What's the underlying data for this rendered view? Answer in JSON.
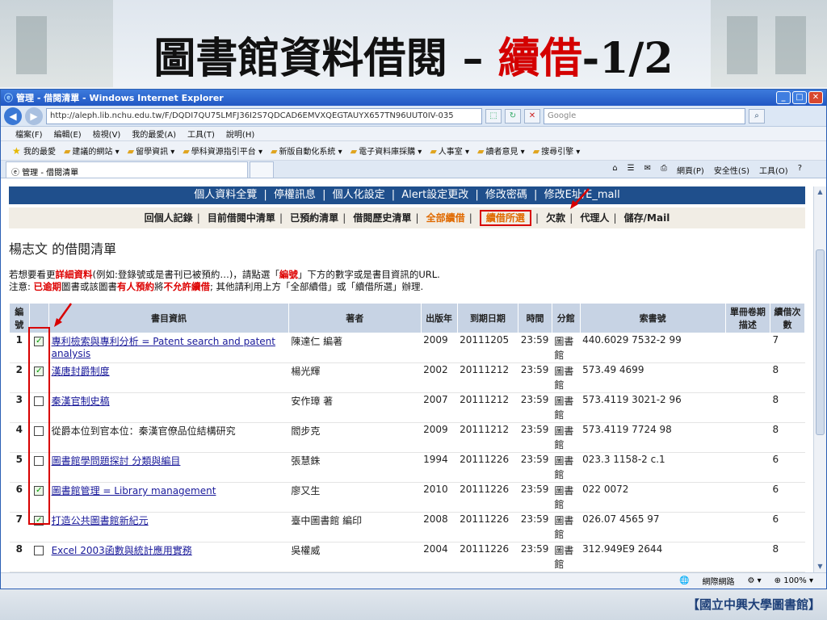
{
  "slide": {
    "title_main": "圖書館資料借閱 – ",
    "title_highlight": "續借",
    "title_suffix": "-1/2",
    "footer": "【國立中興大學圖書館】"
  },
  "browser": {
    "window_title": "管理 - 借閱清單 - Windows Internet Explorer",
    "url": "http://aleph.lib.nchu.edu.tw/F/DQDI7QU75LMFJ36I2S7QDCAD6EMVXQEGTAUYX657TN96UUT0IV-035",
    "search_placeholder": "Google",
    "menu": [
      "檔案(F)",
      "編輯(E)",
      "檢視(V)",
      "我的最愛(A)",
      "工具(T)",
      "說明(H)"
    ],
    "favorites": [
      "我的最愛",
      "建議的網站",
      "留學資訊",
      "學科資源指引平台",
      "新版自動化系統",
      "電子資料庫採購",
      "人事室",
      "讀者意見",
      "搜尋引擎"
    ],
    "tab_title": "管理 - 借閱清單",
    "commands": [
      "網頁(P)",
      "安全性(S)",
      "工具(O)"
    ],
    "status_zone": "網際網路",
    "zoom": "100%"
  },
  "page": {
    "top_nav": [
      "個人資料全覽",
      "停權訊息",
      "個人化設定",
      "Alert設定更改",
      "修改密碼",
      "修改E址/E_mall"
    ],
    "sub_nav": [
      "回個人記錄",
      "目前借閱中清單",
      "已預約清單",
      "借閱歷史清單",
      "全部續借",
      "續借所選",
      "欠款",
      "代理人",
      "儲存/Mail"
    ],
    "owner_heading": "楊志文 的借閱清單",
    "note1_a": "若想要看更",
    "note1_red": "詳細資料",
    "note1_b": "(例如:登錄號或是書刊已被預約…)，請點選「",
    "note1_red2": "編號",
    "note1_c": "」下方的數字或是書目資訊的URL.",
    "note2_a": "注意: ",
    "note2_red": "已逾期",
    "note2_b": "圖書或該圖書",
    "note2_red2": "有人預約",
    "note2_c": "將",
    "note2_red3": "不允許續借",
    "note2_d": "; 其他請利用上方「全部續借」或「續借所選」辦理."
  },
  "table": {
    "headers": [
      "編號",
      "",
      "書目資訊",
      "著者",
      "出版年",
      "到期日期",
      "時間",
      "分館",
      "索書號",
      "單冊卷期描述",
      "續借次數"
    ],
    "rows": [
      {
        "num": "1",
        "checked": true,
        "title": "專利檢索與專利分析 = Patent search and patent analysis",
        "link": true,
        "author": "陳達仁 編著",
        "year": "2009",
        "due": "20111205",
        "time": "23:59",
        "branch": "圖書館",
        "callno": "440.6029 7532-2 99",
        "vol": "",
        "renew": "7"
      },
      {
        "num": "2",
        "checked": true,
        "title": "漢唐封爵制度",
        "link": true,
        "author": "楊光輝",
        "year": "2002",
        "due": "20111212",
        "time": "23:59",
        "branch": "圖書館",
        "callno": "573.49 4699",
        "vol": "",
        "renew": "8"
      },
      {
        "num": "3",
        "checked": false,
        "title": "秦漢官制史稿",
        "link": true,
        "author": "安作璋 著",
        "year": "2007",
        "due": "20111212",
        "time": "23:59",
        "branch": "圖書館",
        "callno": "573.4119 3021-2 96",
        "vol": "",
        "renew": "8"
      },
      {
        "num": "4",
        "checked": false,
        "title": "從爵本位到官本位：秦漢官僚品位結構研究",
        "link": false,
        "author": "閻步克",
        "year": "2009",
        "due": "20111212",
        "time": "23:59",
        "branch": "圖書館",
        "callno": "573.4119 7724 98",
        "vol": "",
        "renew": "8"
      },
      {
        "num": "5",
        "checked": false,
        "title": "圖書館學問題探討 分類與編目",
        "link": true,
        "author": "張慧銖",
        "year": "1994",
        "due": "20111226",
        "time": "23:59",
        "branch": "圖書館",
        "callno": "023.3 1158-2 c.1",
        "vol": "",
        "renew": "6"
      },
      {
        "num": "6",
        "checked": true,
        "title": "圖書館管理 = Library management",
        "link": true,
        "author": "廖又生",
        "year": "2010",
        "due": "20111226",
        "time": "23:59",
        "branch": "圖書館",
        "callno": "022 0072",
        "vol": "",
        "renew": "6"
      },
      {
        "num": "7",
        "checked": true,
        "title": "打造公共圖書館新紀元",
        "link": true,
        "author": "臺中圖書館 編印",
        "year": "2008",
        "due": "20111226",
        "time": "23:59",
        "branch": "圖書館",
        "callno": "026.07 4565 97",
        "vol": "",
        "renew": "6"
      },
      {
        "num": "8",
        "checked": false,
        "title": "Excel 2003函數與統計應用實務",
        "link": true,
        "author": "吳權威",
        "year": "2004",
        "due": "20111226",
        "time": "23:59",
        "branch": "圖書館",
        "callno": "312.949E9 2644",
        "vol": "",
        "renew": "8"
      }
    ]
  },
  "colors": {
    "nav_bg": "#1f4f8c",
    "highlight": "#d80000",
    "accent": "#e06a00"
  }
}
